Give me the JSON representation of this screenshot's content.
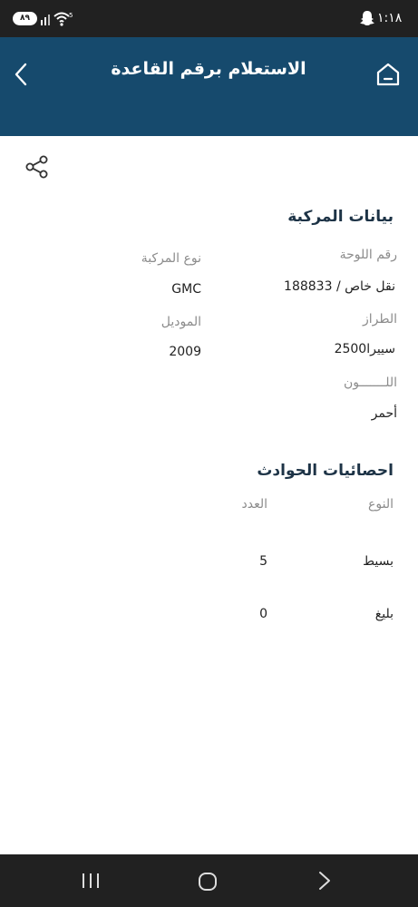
{
  "status_bar": {
    "battery": "٨٩",
    "network": "5",
    "time": "١:١٨",
    "icons": [
      "battery-icon",
      "signal-icon",
      "wifi-icon",
      "snapchat-icon"
    ]
  },
  "header": {
    "title": "الاستعلام برقم القاعدة",
    "back_icon": "chevron-left-icon",
    "home_icon": "home-icon"
  },
  "share_icon": "share-icon",
  "vehicle": {
    "section_title": "بيانات المركبة",
    "fields": [
      {
        "label": "رقم اللوحة",
        "value": "نقل خاص / 188833"
      },
      {
        "label": "نوع المركبة",
        "value": "GMC"
      },
      {
        "label": "الطراز",
        "value": "سييرا2500"
      },
      {
        "label": "الموديل",
        "value": "2009"
      },
      {
        "label": "اللـــــــون",
        "value": "أحمر"
      }
    ]
  },
  "accidents": {
    "section_title": "احصائيات الحوادث",
    "columns": [
      "النوع",
      "العدد"
    ],
    "rows": [
      {
        "type": "بسيط",
        "count": "5"
      },
      {
        "type": "بليغ",
        "count": "0"
      }
    ]
  },
  "nav_bar": {
    "icons": [
      "recent-apps-icon",
      "home-circle-icon",
      "back-chevron-icon"
    ]
  }
}
